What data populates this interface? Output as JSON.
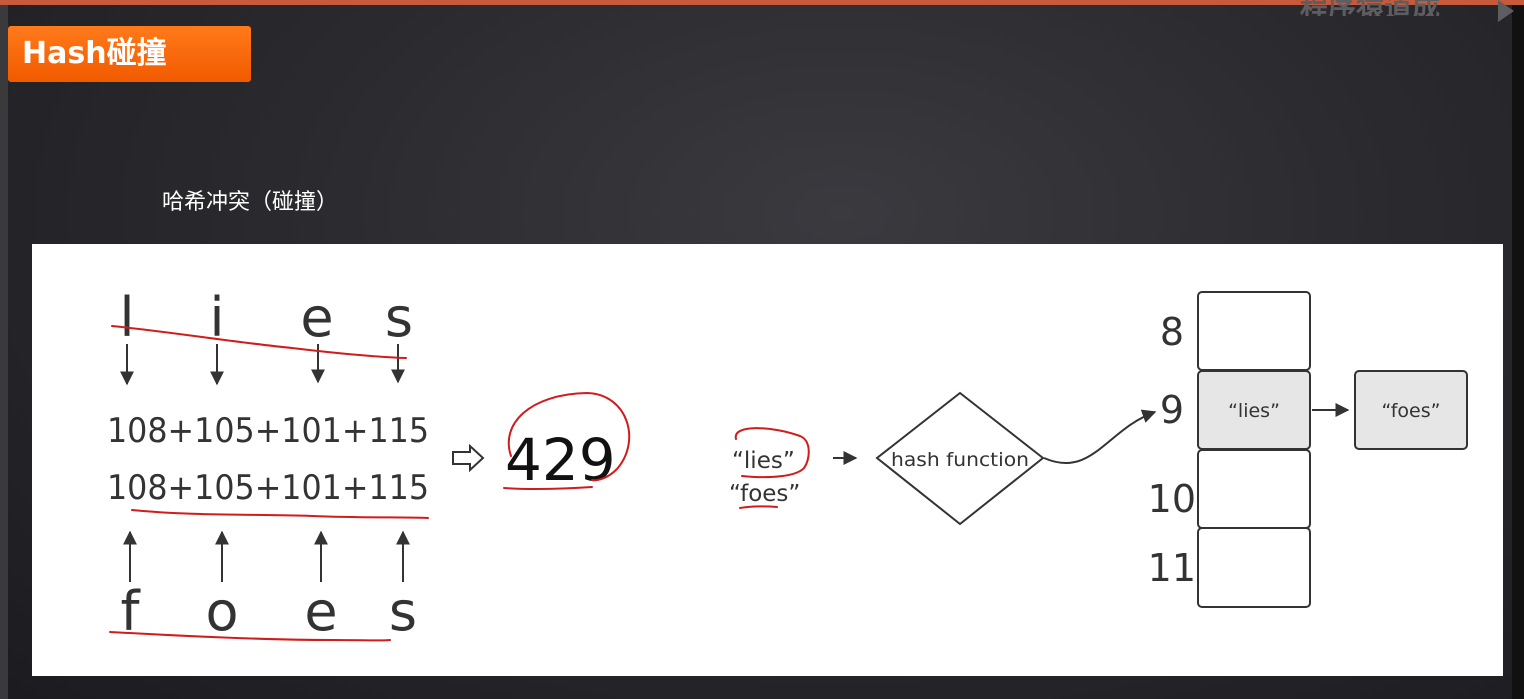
{
  "header": {
    "watermark": "程序猿道成",
    "title": "Hash碰撞",
    "subtitle": "哈希冲突（碰撞）"
  },
  "diagram": {
    "word1_letters": [
      "l",
      "i",
      "e",
      "s"
    ],
    "word2_letters": [
      "f",
      "o",
      "e",
      "s"
    ],
    "sum_line1": "108+105+101+115",
    "sum_line2": "108+105+101+115",
    "result": "429",
    "input_key1": "“lies”",
    "input_key2": "“foes”",
    "hash_function_label": "hash function",
    "bucket_indices": [
      "8",
      "9",
      "10",
      "11"
    ],
    "bucket_entry": "“lies”",
    "chained_entry": "“foes”",
    "colors": {
      "annotation": "#d01c1c",
      "cell_fill": "#e6e6e6",
      "badge": "#f96a0c"
    }
  }
}
